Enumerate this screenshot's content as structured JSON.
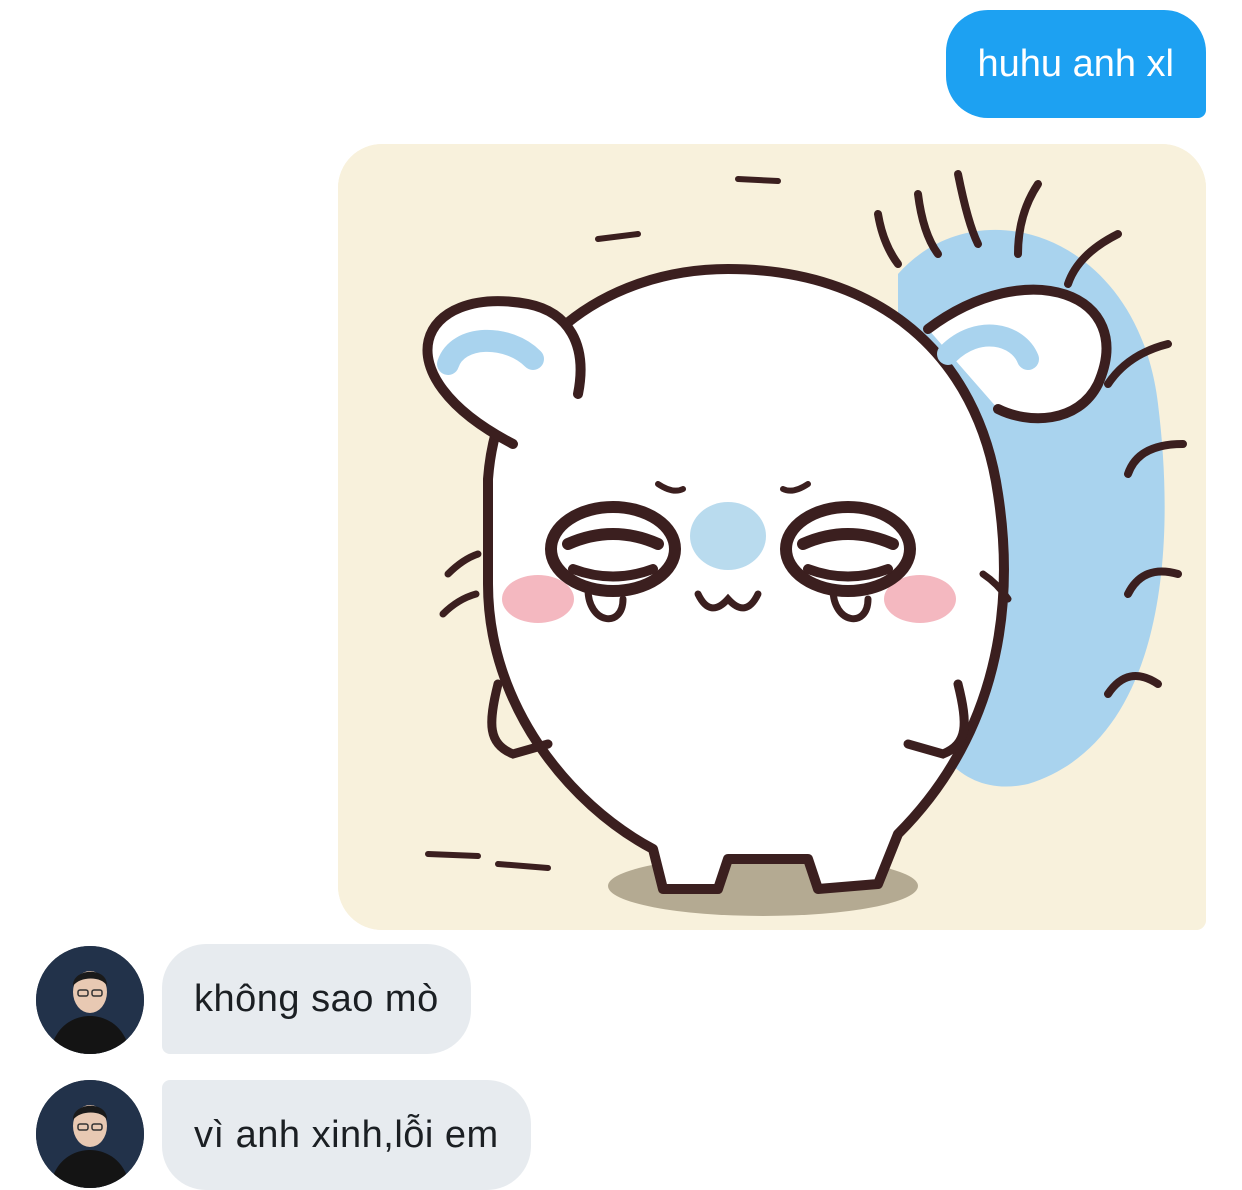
{
  "conversation": {
    "messages": [
      {
        "direction": "outgoing",
        "type": "text",
        "text": "huhu anh xl"
      },
      {
        "direction": "outgoing",
        "type": "image",
        "image": "crying-white-hamster-sticker"
      },
      {
        "direction": "incoming",
        "type": "text",
        "text": "không sao mò",
        "avatar": "avatar-man-glasses-black-hoodie"
      },
      {
        "direction": "incoming",
        "type": "text",
        "text": "vì anh xinh,lỗi em",
        "avatar": "avatar-man-glasses-black-hoodie"
      }
    ]
  },
  "colors": {
    "outgoing_bubble": "#1da1f2",
    "incoming_bubble": "#e7ebef",
    "sticker_background": "#f8f1dc",
    "sticker_blue_accent": "#a9d3ee"
  }
}
